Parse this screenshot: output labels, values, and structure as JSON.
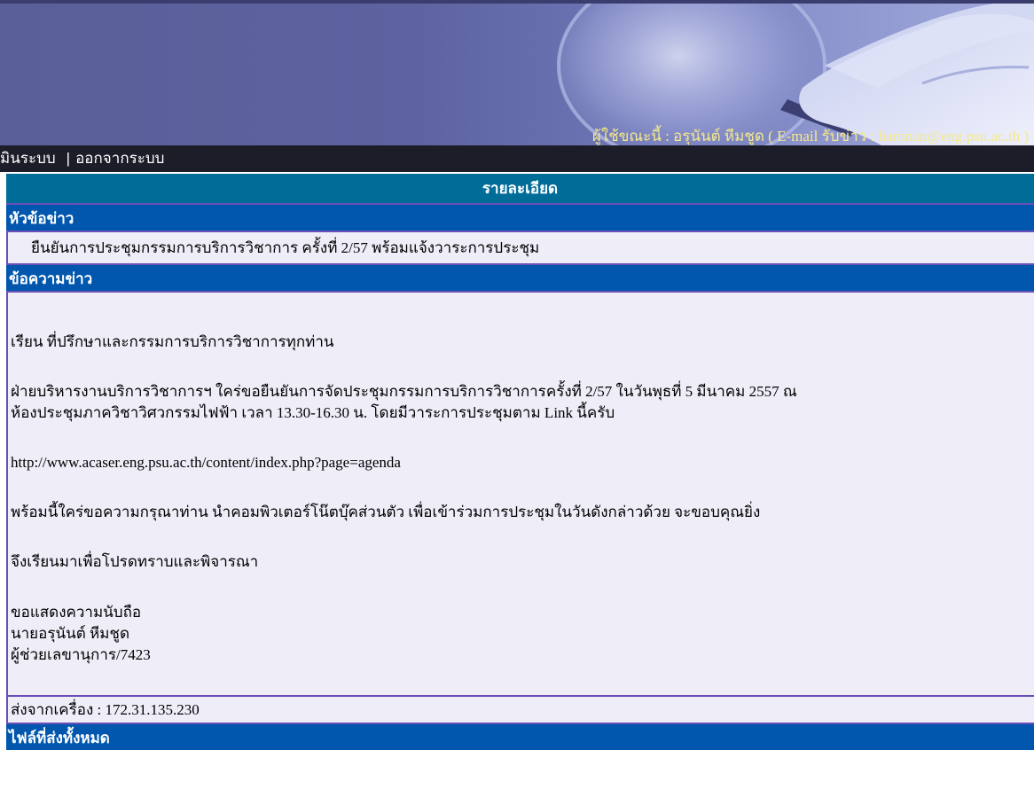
{
  "banner": {
    "user_label": "ผู้ใช้ขณะนี้ : อรุนันต์ หีมชูด ( E-mail รับข่าว : harunan@eng.psu.ac.th )"
  },
  "menu": {
    "admin": "มินระบบ",
    "separator": "|",
    "logout": "ออกจากระบบ"
  },
  "detail": {
    "title": "รายละเอียด",
    "subject_header": "หัวข้อข่าว",
    "subject": "ยืนยันการประชุมกรรมการบริการวิชาการ ครั้งที่ 2/57 พร้อมแจ้งวาระการประชุม",
    "message_header": "ข้อความข่าว",
    "message": {
      "greeting": "เรียน ที่ปรึกษาและกรรมการบริการวิชาการทุกท่าน",
      "para1_line1": "ฝ่ายบริหารงานบริการวิชาการฯ ใคร่ขอยืนยันการจัดประชุมกรรมการบริการวิชาการครั้งที่ 2/57 ในวันพุธที่ 5 มีนาคม 2557 ณ",
      "para1_line2": "ห้องประชุมภาควิชาวิศวกรรมไฟฟ้า เวลา 13.30-16.30 น. โดยมีวาระการประชุมตาม Link นี้ครับ",
      "link": "http://www.acaser.eng.psu.ac.th/content/index.php?page=agenda",
      "para2": "พร้อมนี้ใคร่ขอความกรุณาท่าน นำคอมพิวเตอร์โน๊ตบุ๊คส่วนตัว เพื่อเข้าร่วมการประชุมในวันดังกล่าวด้วย จะขอบคุณยิ่ง",
      "para3": "จึงเรียนมาเพื่อโปรดทราบและพิจารณา",
      "closing": "ขอแสดงความนับถือ",
      "signer": "นายอรุนันต์ หีมชูด",
      "position": "ผู้ช่วยเลขานุการ/7423"
    },
    "sender": "ส่งจากเครื่อง : 172.31.135.230",
    "files_header": "ไฟล์ที่ส่งทั้งหมด"
  }
}
